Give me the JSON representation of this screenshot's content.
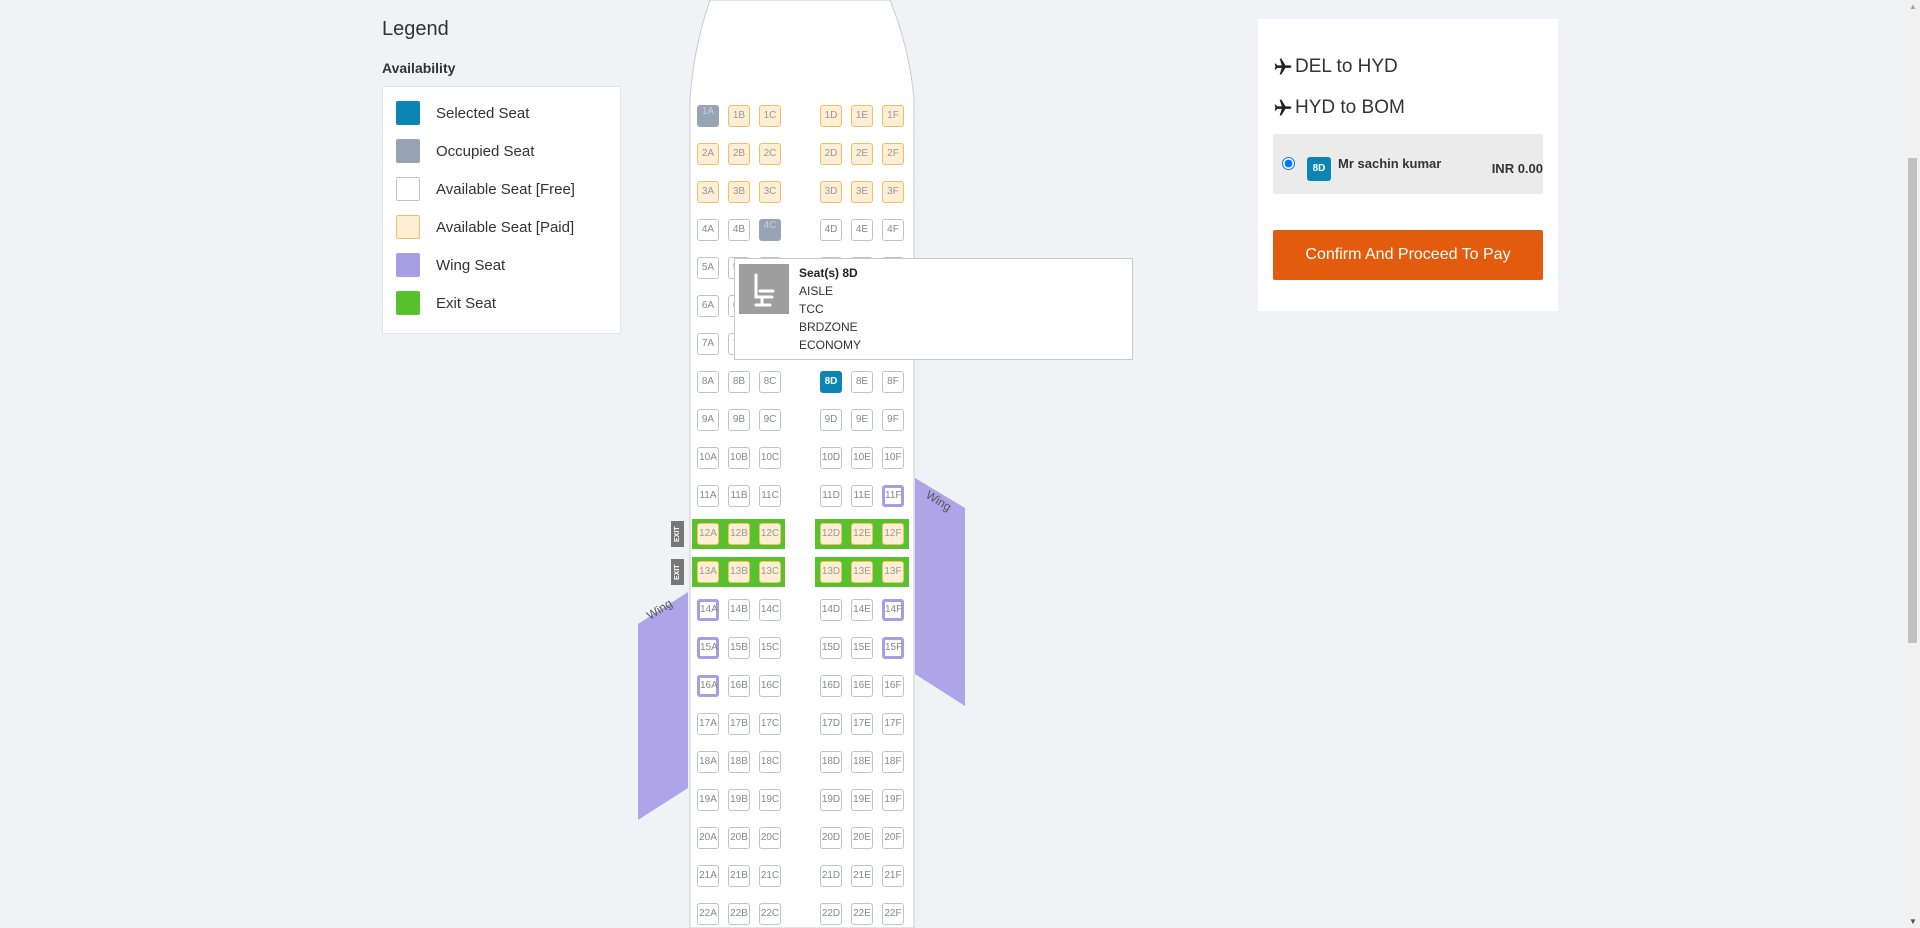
{
  "legend": {
    "title": "Legend",
    "subtitle": "Availability",
    "items": [
      {
        "label": "Selected Seat",
        "color": "#0a85b4",
        "border": "#0a85b4"
      },
      {
        "label": "Occupied Seat",
        "color": "#98a3b3",
        "border": "#98a3b3"
      },
      {
        "label": "Available Seat [Free]",
        "color": "#ffffff",
        "border": "#bfc4cc"
      },
      {
        "label": "Available Seat [Paid]",
        "color": "#fdeed5",
        "border": "#f4be63"
      },
      {
        "label": "Wing Seat",
        "color": "#a79ee3",
        "border": "#a79ee3"
      },
      {
        "label": "Exit Seat",
        "color": "#58c12e",
        "border": "#58c12e"
      }
    ]
  },
  "seatmap": {
    "rows": [
      1,
      2,
      3,
      4,
      5,
      6,
      7,
      8,
      9,
      10,
      11,
      12,
      13,
      14,
      15,
      16,
      17,
      18,
      19,
      20,
      21,
      22
    ],
    "columns": [
      "A",
      "B",
      "C",
      "D",
      "E",
      "F"
    ],
    "paid_seats": [
      "1B",
      "1C",
      "1D",
      "1E",
      "1F",
      "2A",
      "2B",
      "2C",
      "2D",
      "2E",
      "2F",
      "3A",
      "3B",
      "3C",
      "3D",
      "3E",
      "3F",
      "12A",
      "12B",
      "12C",
      "12D",
      "12E",
      "12F",
      "13A",
      "13B",
      "13C",
      "13D",
      "13E",
      "13F"
    ],
    "occupied_seats": [
      "1A",
      "4C"
    ],
    "selected_seats": [
      "8D"
    ],
    "wing_seats": [
      "11F",
      "14A",
      "14F",
      "15A",
      "15F",
      "16A"
    ],
    "exit_rows": [
      12,
      13
    ],
    "exit_label": "EXIT",
    "wing_label": "Wing"
  },
  "tooltip": {
    "title": "Seat(s) 8D",
    "lines": [
      "AISLE",
      "TCC",
      "BRDZONE",
      "ECONOMY"
    ]
  },
  "summary": {
    "routes": [
      "DEL to HYD",
      "HYD to BOM"
    ],
    "passenger": {
      "seat": "8D",
      "name": "Mr sachin kumar",
      "price": "INR 0.00"
    },
    "confirm_label": "Confirm And Proceed To Pay"
  },
  "colors": {
    "selected": "#0a85b4",
    "occupied": "#98a3b3",
    "paid": "#fdeed5",
    "wing": "#a79ee3",
    "exit": "#58c12e",
    "confirm_button": "#e35c0d"
  }
}
